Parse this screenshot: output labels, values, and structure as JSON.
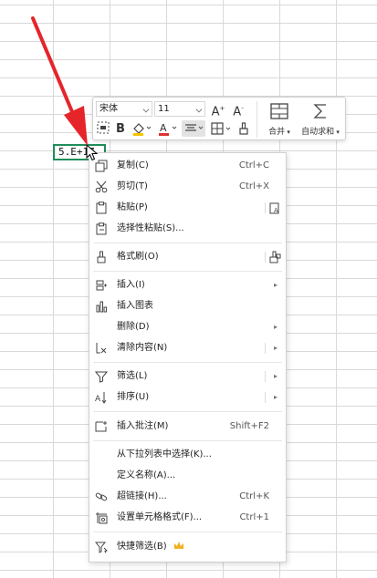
{
  "cell": {
    "value": "5.E+17"
  },
  "toolbar": {
    "font_name": "宋体",
    "font_size": "11",
    "grow_font": "A",
    "shrink_font": "A",
    "bold": "B",
    "merge_label": "合并",
    "autosum_label": "自动求和"
  },
  "menu": {
    "items": [
      {
        "label": "复制(C)",
        "shortcut": "Ctrl+C"
      },
      {
        "label": "剪切(T)",
        "shortcut": "Ctrl+X"
      },
      {
        "label": "粘贴(P)",
        "shortcut": ""
      },
      {
        "label": "选择性粘贴(S)...",
        "shortcut": ""
      },
      {
        "label": "格式刷(O)",
        "shortcut": ""
      },
      {
        "label": "插入(I)",
        "shortcut": ""
      },
      {
        "label": "插入图表",
        "shortcut": ""
      },
      {
        "label": "删除(D)",
        "shortcut": ""
      },
      {
        "label": "清除内容(N)",
        "shortcut": ""
      },
      {
        "label": "筛选(L)",
        "shortcut": ""
      },
      {
        "label": "排序(U)",
        "shortcut": ""
      },
      {
        "label": "插入批注(M)",
        "shortcut": "Shift+F2"
      },
      {
        "label": "从下拉列表中选择(K)...",
        "shortcut": ""
      },
      {
        "label": "定义名称(A)...",
        "shortcut": ""
      },
      {
        "label": "超链接(H)...",
        "shortcut": "Ctrl+K"
      },
      {
        "label": "设置单元格格式(F)...",
        "shortcut": "Ctrl+1"
      },
      {
        "label": "快捷筛选(B)",
        "shortcut": ""
      }
    ]
  },
  "colors": {
    "accent": "#1f8e5b",
    "arrow": "#e5252a",
    "font_color_bar": "#e03131",
    "highlight_bar": "#f5c400"
  }
}
